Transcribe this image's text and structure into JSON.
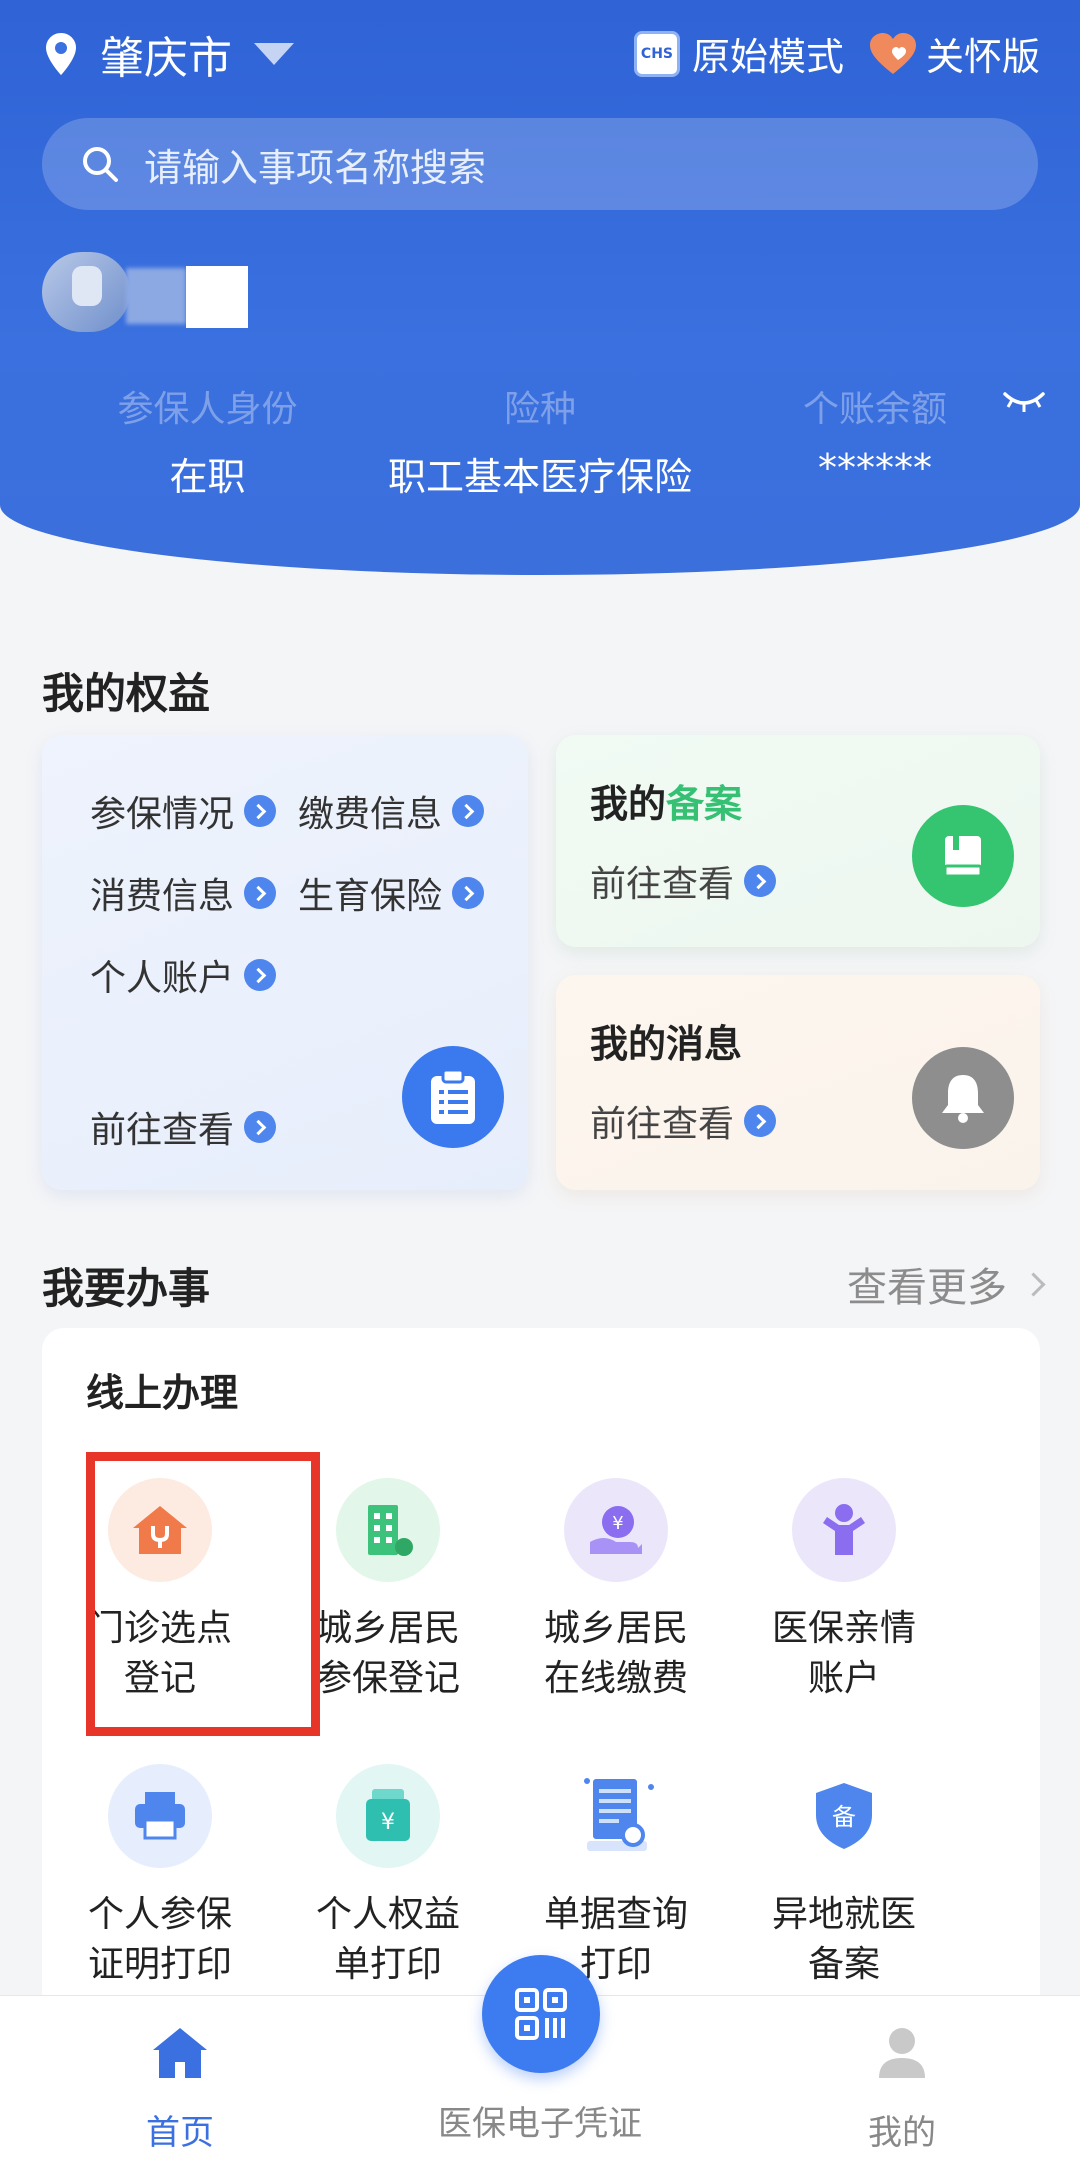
{
  "header": {
    "city": "肇庆市",
    "original_mode_label": "原始模式",
    "care_version_label": "关怀版",
    "search_placeholder": "请输入事项名称搜索",
    "info": [
      {
        "label": "参保人身份",
        "value": "在职"
      },
      {
        "label": "险种",
        "value": "职工基本医疗保险"
      },
      {
        "label": "个账余额",
        "value": "******"
      }
    ]
  },
  "benefits": {
    "title": "我的权益",
    "left_card": {
      "links": [
        "参保情况",
        "缴费信息",
        "消费信息",
        "生育保险",
        "个人账户"
      ],
      "go_label": "前往查看"
    },
    "filing_card": {
      "title_prefix": "我的",
      "title_highlight": "备案",
      "go_label": "前往查看"
    },
    "message_card": {
      "title": "我的消息",
      "go_label": "前往查看"
    }
  },
  "services": {
    "title": "我要办事",
    "more_label": "查看更多",
    "panel_title": "线上办理",
    "items": [
      {
        "line1": "门诊选点",
        "line2": "登记",
        "icon": "clinic-house-icon",
        "color": "#f07a4a"
      },
      {
        "line1": "城乡居民",
        "line2": "参保登记",
        "icon": "building-icon",
        "color": "#3cc27a"
      },
      {
        "line1": "城乡居民",
        "line2": "在线缴费",
        "icon": "yuan-hand-icon",
        "color": "#8b6ef0"
      },
      {
        "line1": "医保亲情",
        "line2": "账户",
        "icon": "family-person-icon",
        "color": "#8b6ef0"
      },
      {
        "line1": "个人参保",
        "line2": "证明打印",
        "icon": "printer-icon",
        "color": "#4e86ee"
      },
      {
        "line1": "个人权益",
        "line2": "单打印",
        "icon": "yuan-wallet-icon",
        "color": "#2fbfb0"
      },
      {
        "line1": "单据查询",
        "line2": "打印",
        "icon": "document-search-icon",
        "color": "#4e86ee"
      },
      {
        "line1": "异地就医",
        "line2": "备案",
        "icon": "shield-filing-icon",
        "color": "#4e86ee",
        "badge": "备"
      }
    ]
  },
  "bottom_nav": {
    "home": "首页",
    "voucher": "医保电子凭证",
    "mine": "我的"
  },
  "colors": {
    "accent": "#3a70df",
    "highlight_border": "#e8352a"
  }
}
